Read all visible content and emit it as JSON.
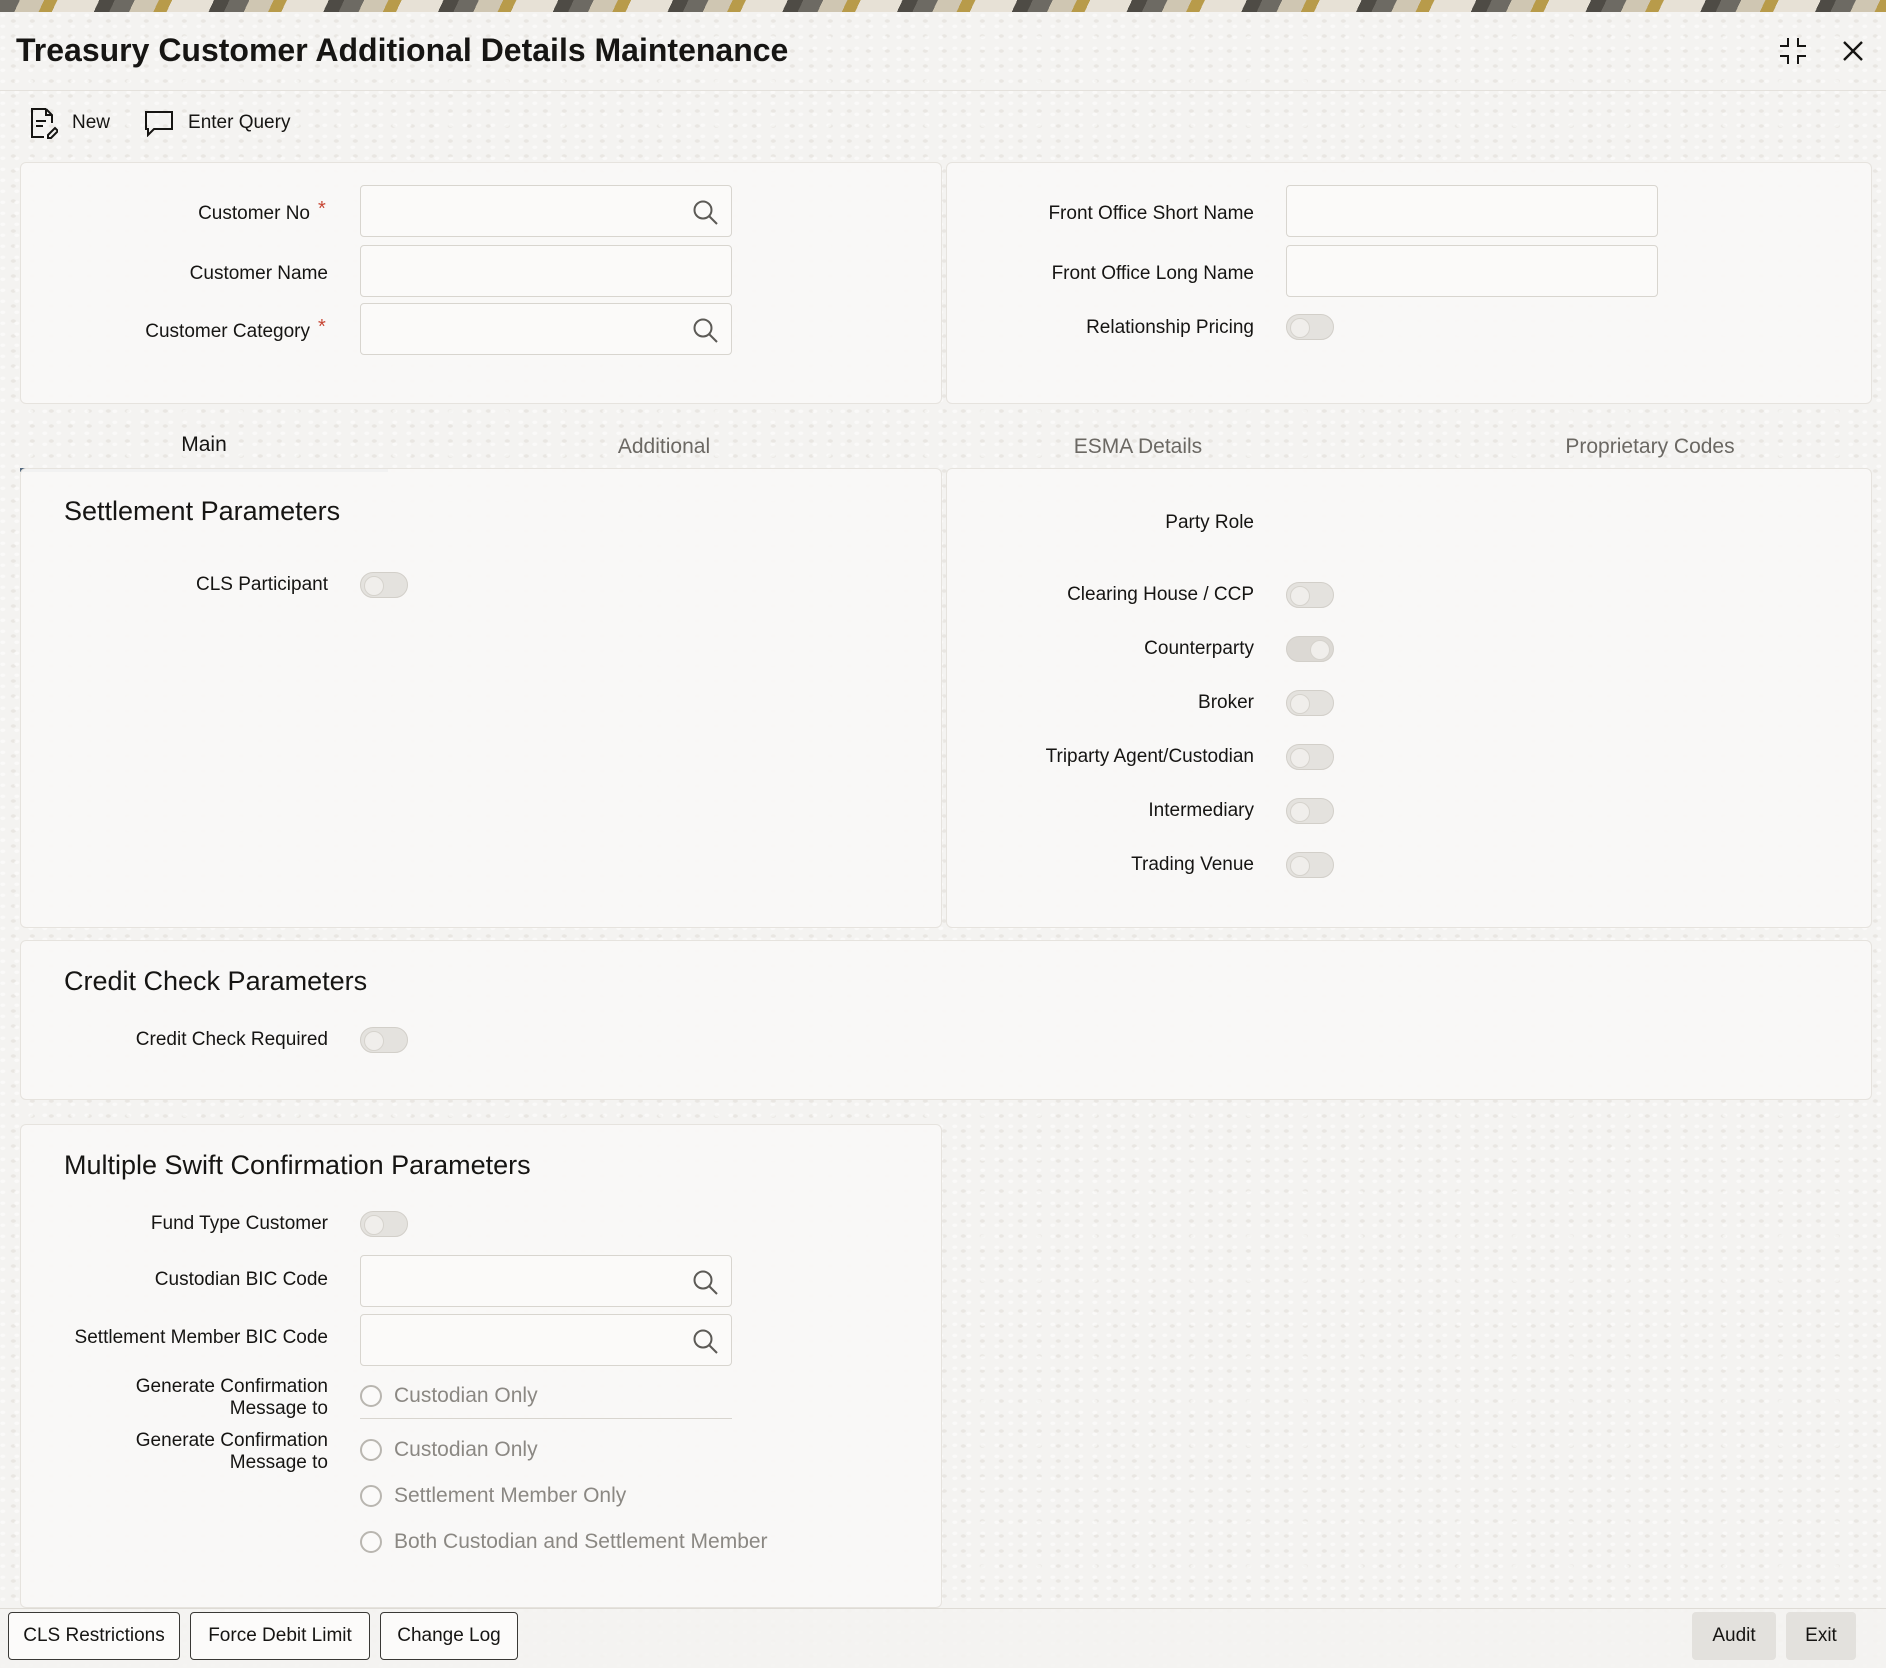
{
  "window": {
    "title": "Treasury Customer Additional Details Maintenance",
    "icons": [
      "maximize-icon",
      "close-icon"
    ]
  },
  "toolbar": {
    "new_label": "New",
    "enter_query_label": "Enter Query"
  },
  "header": {
    "customer_no_label": "Customer No",
    "customer_name_label": "Customer Name",
    "customer_category_label": "Customer Category",
    "required_mark": "*",
    "front_office_short_name_label": "Front Office Short Name",
    "front_office_long_name_label": "Front Office Long Name",
    "relationship_pricing_label": "Relationship Pricing"
  },
  "tabs": [
    "Main",
    "Additional",
    "ESMA Details",
    "Proprietary Codes"
  ],
  "settlement": {
    "title": "Settlement Parameters",
    "cls_participant_label": "CLS Participant"
  },
  "party_role": {
    "heading": "Party Role",
    "items": [
      "Clearing House / CCP",
      "Counterparty",
      "Broker",
      "Triparty Agent/Custodian",
      "Intermediary",
      "Trading Venue"
    ]
  },
  "credit_check": {
    "title": "Credit Check Parameters",
    "required_label": "Credit Check Required"
  },
  "swift": {
    "title": "Multiple Swift Confirmation Parameters",
    "fund_type_label": "Fund Type Customer",
    "custodian_bic_label": "Custodian BIC Code",
    "settlement_bic_label": "Settlement Member BIC Code",
    "gen_conf_label_1": "Generate Confirmation Message to",
    "gen_conf_option_1": "Custodian Only",
    "gen_conf_label_2": "Generate Confirmation Message to",
    "options": [
      "Custodian Only",
      "Settlement Member Only",
      "Both Custodian and Settlement Member"
    ]
  },
  "footer": {
    "cls_restrictions": "CLS Restrictions",
    "force_debit_limit": "Force Debit Limit",
    "change_log": "Change Log",
    "audit": "Audit",
    "exit": "Exit"
  },
  "colors": {
    "accent": "#51677d",
    "required": "#c74634",
    "text": "#161513",
    "muted": "#6b6863"
  }
}
